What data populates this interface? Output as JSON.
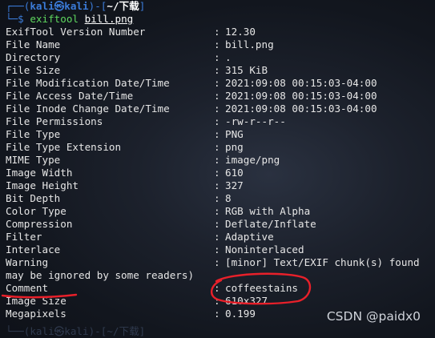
{
  "prompt": {
    "top_open": "┌──(",
    "user": "kali㉿kali",
    "top_mid": ")-[",
    "path": "~/下载",
    "top_close": "]",
    "bottom": "└─$ ",
    "command": "exiftool",
    "argument": "bill.png"
  },
  "rows": [
    {
      "key": "ExifTool Version Number",
      "value": "12.30"
    },
    {
      "key": "File Name",
      "value": "bill.png"
    },
    {
      "key": "Directory",
      "value": "."
    },
    {
      "key": "File Size",
      "value": "315 KiB"
    },
    {
      "key": "File Modification Date/Time",
      "value": "2021:09:08 00:15:03-04:00"
    },
    {
      "key": "File Access Date/Time",
      "value": "2021:09:08 00:15:03-04:00"
    },
    {
      "key": "File Inode Change Date/Time",
      "value": "2021:09:08 00:15:03-04:00"
    },
    {
      "key": "File Permissions",
      "value": "-rw-r--r--"
    },
    {
      "key": "File Type",
      "value": "PNG"
    },
    {
      "key": "File Type Extension",
      "value": "png"
    },
    {
      "key": "MIME Type",
      "value": "image/png"
    },
    {
      "key": "Image Width",
      "value": "610"
    },
    {
      "key": "Image Height",
      "value": "327"
    },
    {
      "key": "Bit Depth",
      "value": "8"
    },
    {
      "key": "Color Type",
      "value": "RGB with Alpha"
    },
    {
      "key": "Compression",
      "value": "Deflate/Inflate"
    },
    {
      "key": "Filter",
      "value": "Adaptive"
    },
    {
      "key": "Interlace",
      "value": "Noninterlaced"
    },
    {
      "key": "Warning",
      "value": "[minor] Text/EXIF chunk(s) found"
    }
  ],
  "warning_continuation": "may be ignored by some readers)",
  "rows_after": [
    {
      "key": "Comment",
      "value": "coffeestains"
    },
    {
      "key": "Image Size",
      "value": "610x327"
    },
    {
      "key": "Megapixels",
      "value": "0.199"
    }
  ],
  "separator": ":",
  "ghost_prompt": "└──(kali㉿kali)-[~/下载]",
  "watermark": "CSDN @paidx0",
  "annotation_color": "#e8202a"
}
